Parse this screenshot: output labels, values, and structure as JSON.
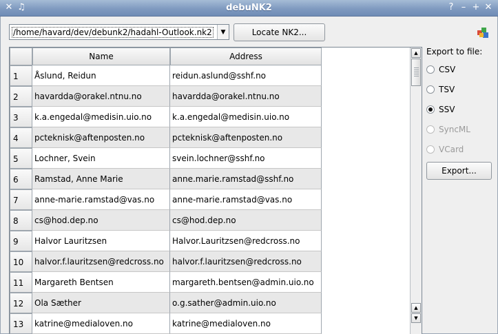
{
  "window": {
    "title": "debuNK2"
  },
  "toolbar": {
    "file_path": "/home/havard/dev/debunk2/hadahl-Outlook.nk2",
    "locate_button": "Locate NK2..."
  },
  "table": {
    "columns": [
      "Name",
      "Address"
    ],
    "rows": [
      {
        "num": "1",
        "name": "Åslund, Reidun",
        "address": "reidun.aslund@sshf.no"
      },
      {
        "num": "2",
        "name": "havardda@orakel.ntnu.no",
        "address": "havardda@orakel.ntnu.no"
      },
      {
        "num": "3",
        "name": "k.a.engedal@medisin.uio.no",
        "address": "k.a.engedal@medisin.uio.no"
      },
      {
        "num": "4",
        "name": "pcteknisk@aftenposten.no",
        "address": "pcteknisk@aftenposten.no"
      },
      {
        "num": "5",
        "name": "Lochner, Svein",
        "address": "svein.lochner@sshf.no"
      },
      {
        "num": "6",
        "name": "Ramstad, Anne Marie",
        "address": "anne.marie.ramstad@sshf.no"
      },
      {
        "num": "7",
        "name": "anne-marie.ramstad@vas.no",
        "address": "anne-marie.ramstad@vas.no"
      },
      {
        "num": "8",
        "name": "cs@hod.dep.no",
        "address": "cs@hod.dep.no"
      },
      {
        "num": "9",
        "name": "Halvor Lauritzsen",
        "address": "Halvor.Lauritzsen@redcross.no"
      },
      {
        "num": "10",
        "name": "halvor.f.lauritzsen@redcross.no",
        "address": "halvor.f.lauritzsen@redcross.no"
      },
      {
        "num": "11",
        "name": "Margareth Bentsen",
        "address": "margareth.bentsen@admin.uio.no"
      },
      {
        "num": "12",
        "name": "Ola Sæther",
        "address": "o.g.sather@admin.uio.no"
      },
      {
        "num": "13",
        "name": "katrine@medialoven.no",
        "address": "katrine@medialoven.no"
      }
    ]
  },
  "export": {
    "label": "Export to file:",
    "options": [
      {
        "label": "CSV",
        "selected": false,
        "enabled": true
      },
      {
        "label": "TSV",
        "selected": false,
        "enabled": true
      },
      {
        "label": "SSV",
        "selected": true,
        "enabled": true
      },
      {
        "label": "SyncML",
        "selected": false,
        "enabled": false
      },
      {
        "label": "VCard",
        "selected": false,
        "enabled": false
      }
    ],
    "button": "Export..."
  }
}
